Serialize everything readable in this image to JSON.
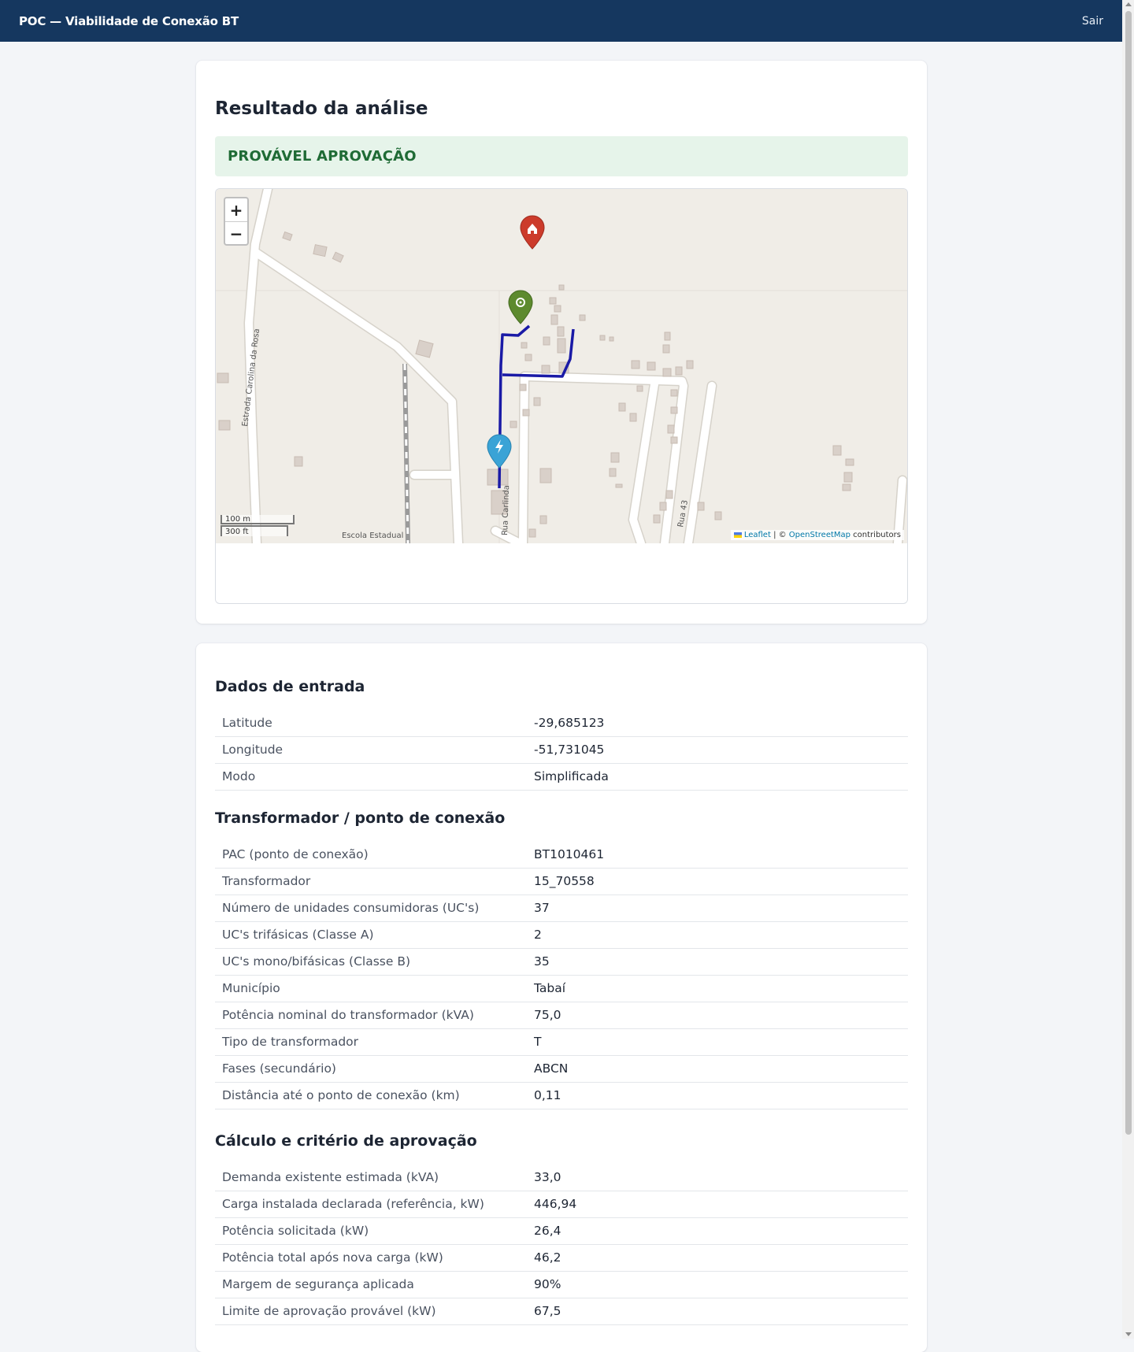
{
  "header": {
    "title": "POC — Viabilidade de Conexão BT",
    "logout_label": "Sair"
  },
  "result": {
    "title": "Resultado da análise",
    "status": "PROVÁVEL APROVAÇÃO",
    "status_color": "#1f6b35",
    "status_bg": "#e6f4ea"
  },
  "map": {
    "zoom_in": "+",
    "zoom_out": "−",
    "scale_metric": "100 m",
    "scale_imperial": "300 ft",
    "attribution_leaflet": "Leaflet",
    "attribution_sep": " | © ",
    "attribution_osm": "OpenStreetMap",
    "attribution_tail": " contributors",
    "labels": {
      "road1": "Estrada Carolina da Rosa",
      "road2": "Rua Carlinda",
      "road3": "Rua 43",
      "school": "Escola Estadual"
    },
    "markers": {
      "home": "home-marker",
      "connection_point": "target-marker",
      "transformer": "lightning-marker"
    },
    "route_color": "#1a1aa6"
  },
  "inputs": {
    "title": "Dados de entrada",
    "rows": [
      {
        "label": "Latitude",
        "value": "-29,685123"
      },
      {
        "label": "Longitude",
        "value": "-51,731045"
      },
      {
        "label": "Modo",
        "value": "Simplificada"
      }
    ]
  },
  "transformer": {
    "title": "Transformador / ponto de conexão",
    "rows": [
      {
        "label": "PAC (ponto de conexão)",
        "value": "BT1010461"
      },
      {
        "label": "Transformador",
        "value": "15_70558"
      },
      {
        "label": "Número de unidades consumidoras (UC's)",
        "value": "37"
      },
      {
        "label": "UC's trifásicas (Classe A)",
        "value": "2"
      },
      {
        "label": "UC's mono/bifásicas (Classe B)",
        "value": "35"
      },
      {
        "label": "Município",
        "value": "Tabaí"
      },
      {
        "label": "Potência nominal do transformador (kVA)",
        "value": "75,0"
      },
      {
        "label": "Tipo de transformador",
        "value": "T"
      },
      {
        "label": "Fases (secundário)",
        "value": "ABCN"
      },
      {
        "label": "Distância até o ponto de conexão (km)",
        "value": "0,11"
      }
    ]
  },
  "calculation": {
    "title": "Cálculo e critério de aprovação",
    "rows": [
      {
        "label": "Demanda existente estimada (kVA)",
        "value": "33,0"
      },
      {
        "label": "Carga instalada declarada (referência, kW)",
        "value": "446,94"
      },
      {
        "label": "Potência solicitada (kW)",
        "value": "26,4"
      },
      {
        "label": "Potência total após nova carga (kW)",
        "value": "46,2"
      },
      {
        "label": "Margem de segurança aplicada",
        "value": "90%"
      },
      {
        "label": "Limite de aprovação provável (kW)",
        "value": "67,5"
      }
    ]
  }
}
